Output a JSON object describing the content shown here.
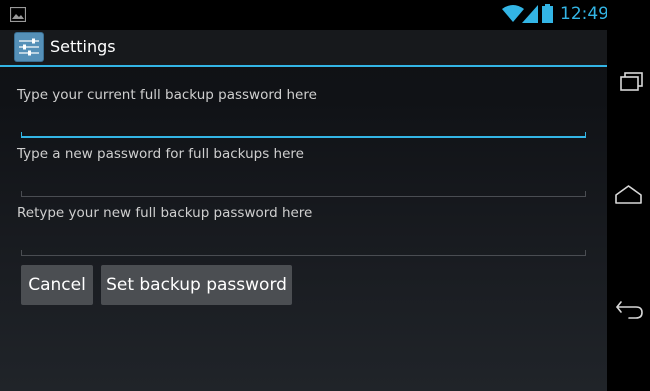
{
  "status_bar": {
    "time": "12:49",
    "icons": [
      "image-notification-icon",
      "wifi-icon",
      "signal-icon",
      "battery-icon"
    ]
  },
  "action_bar": {
    "title": "Settings",
    "app_icon": "settings-icon"
  },
  "form": {
    "fields": [
      {
        "label": "Type your current full backup password here",
        "value": "",
        "focused": true
      },
      {
        "label": "Type a new password for full backups here",
        "value": "",
        "focused": false
      },
      {
        "label": "Retype your new full backup password here",
        "value": "",
        "focused": false
      }
    ]
  },
  "buttons": {
    "cancel": "Cancel",
    "set": "Set backup password"
  },
  "nav_bar": {
    "icons": [
      "recent-apps-icon",
      "home-icon",
      "back-icon"
    ]
  },
  "colors": {
    "accent": "#33b5e5",
    "button": "#4b4e52",
    "background": "#101216"
  }
}
